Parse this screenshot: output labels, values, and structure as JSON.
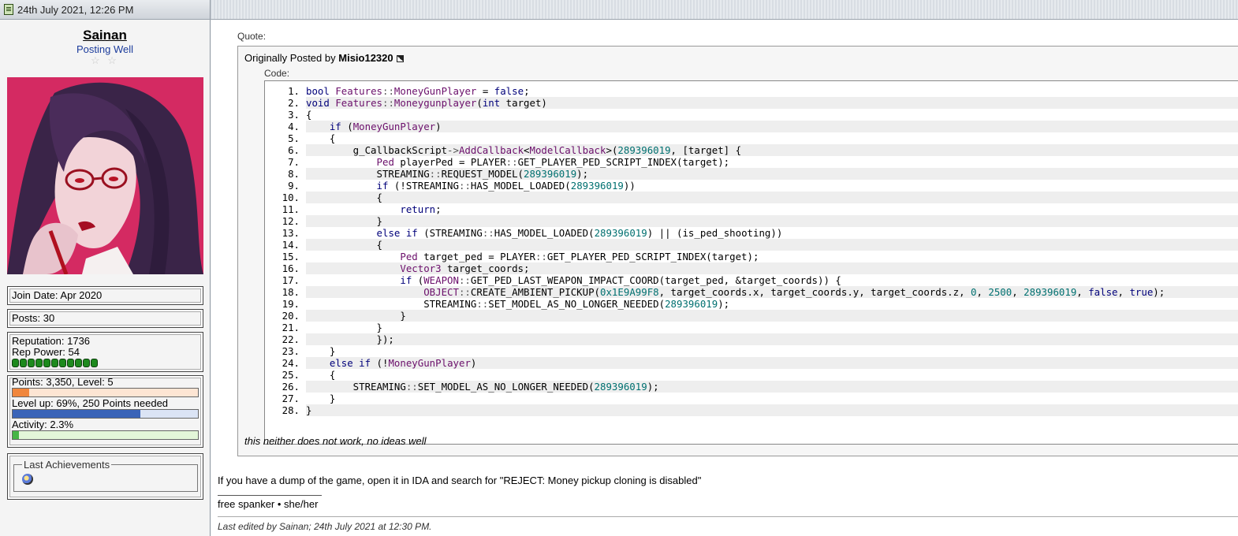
{
  "header": {
    "date": "24th July 2021, 12:26 PM"
  },
  "user": {
    "name": "Sainan",
    "title": "Posting Well",
    "stars": "☆ ☆",
    "join_date": "Join Date: Apr 2020",
    "posts": "Posts: 30",
    "reputation": "Reputation: 1736",
    "rep_power": "Rep Power: 54",
    "points": "Points: 3,350, Level: 5",
    "points_fill": 0.09,
    "level_up": "Level up: 69%, 250 Points needed",
    "level_fill": 0.69,
    "activity": "Activity: 2.3%",
    "activity_fill": 0.035,
    "achievements_label": "Last Achievements"
  },
  "colors": {
    "points_bar": "#f0863c",
    "level_bar": "#3a64b8",
    "activity_bar": "#47b547",
    "avatar_bg": "#d42a62",
    "link": "#1c3c9c"
  },
  "quote": {
    "label": "Quote:",
    "originally_posted_by": "Originally Posted by",
    "author": "Misio12320",
    "code_label": "Code:",
    "footer_text": "this neither does not work, no ideas well"
  },
  "code_lines": [
    "bool Features::MoneyGunPlayer = false;",
    "void Features::Moneygunplayer(int target)",
    "{",
    "    if (MoneyGunPlayer)",
    "    {",
    "        g_CallbackScript->AddCallback<ModelCallback>(289396019, [target] {",
    "            Ped playerPed = PLAYER::GET_PLAYER_PED_SCRIPT_INDEX(target);",
    "            STREAMING::REQUEST_MODEL(289396019);",
    "            if (!STREAMING::HAS_MODEL_LOADED(289396019))",
    "            {",
    "                return;",
    "            }",
    "            else if (STREAMING::HAS_MODEL_LOADED(289396019) || (is_ped_shooting))",
    "            {",
    "                Ped target_ped = PLAYER::GET_PLAYER_PED_SCRIPT_INDEX(target);",
    "                Vector3 target_coords;",
    "                if (WEAPON::GET_PED_LAST_WEAPON_IMPACT_COORD(target_ped, &target_coords)) {",
    "                    OBJECT::CREATE_AMBIENT_PICKUP(0x1E9A99F8, target_coords.x, target_coords.y, target_coords.z, 0, 2500, 289396019, false, true);",
    "                    STREAMING::SET_MODEL_AS_NO_LONGER_NEEDED(289396019);",
    "                }",
    "            }",
    "            });",
    "    }",
    "    else if (!MoneyGunPlayer)",
    "    {",
    "        STREAMING::SET_MODEL_AS_NO_LONGER_NEEDED(289396019);",
    "    }",
    "}"
  ],
  "reply_text": "If you have a dump of the game, open it in IDA and search for \"REJECT: Money pickup cloning is disabled\"",
  "signature": "free spanker • she/her",
  "edited_note": "Last edited by Sainan; 24th July 2021 at 12:30 PM."
}
